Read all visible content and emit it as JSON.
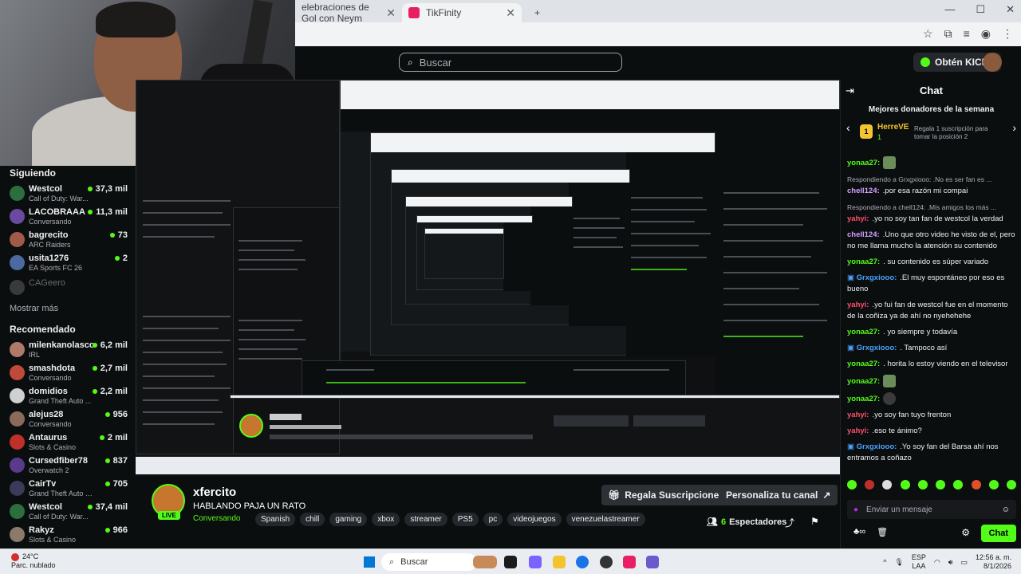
{
  "browser": {
    "tabs": [
      {
        "label": "elebraciones de Gol con Neym",
        "active": false
      },
      {
        "label": "TikFinity",
        "active": true
      }
    ],
    "new_tab": "+",
    "win_minimize": "—",
    "win_maximize": "☐",
    "win_close": "✕"
  },
  "header": {
    "search_placeholder": "Buscar",
    "kicks_button": "Obtén KICKs"
  },
  "sidebar": {
    "following_title": "Siguiendo",
    "following": [
      {
        "name": "Westcol",
        "sub": "Call of Duty: War...",
        "viewers": "37,3 mil",
        "color": "#2b6f3f"
      },
      {
        "name": "LACOBRAAA",
        "sub": "Conversando",
        "viewers": "11,3 mil",
        "color": "#6a4aa0"
      },
      {
        "name": "bagrecito",
        "sub": "ARC Raiders",
        "viewers": "73",
        "color": "#a05a4a"
      },
      {
        "name": "usita1276",
        "sub": "EA Sports FC 26",
        "viewers": "2",
        "color": "#4a6aa0"
      },
      {
        "name": "CAGeero",
        "sub": "",
        "viewers": "",
        "color": "#3a3a3a",
        "offline": true
      }
    ],
    "show_more": "Mostrar más",
    "recommended_title": "Recomendado",
    "recommended": [
      {
        "name": "milenkanolasco",
        "sub": "IRL",
        "viewers": "6,2 mil",
        "color": "#b07a6a"
      },
      {
        "name": "smashdota",
        "sub": "Conversando",
        "viewers": "2,7 mil",
        "color": "#c04a3a"
      },
      {
        "name": "domidios",
        "sub": "Grand Theft Auto ...",
        "viewers": "2,2 mil",
        "color": "#d0d0d0"
      },
      {
        "name": "alejus28",
        "sub": "Conversando",
        "viewers": "956",
        "color": "#8a6a5a"
      },
      {
        "name": "Antaurus",
        "sub": "Slots & Casino",
        "viewers": "2 mil",
        "color": "#c0302a"
      },
      {
        "name": "Cursedfiber78",
        "sub": "Overwatch 2",
        "viewers": "837",
        "color": "#5a3a8a"
      },
      {
        "name": "CairTv",
        "sub": "Grand Theft Auto V (G...",
        "viewers": "705",
        "color": "#3a3a5a"
      },
      {
        "name": "Westcol",
        "sub": "Call of Duty: War...",
        "viewers": "37,4 mil",
        "color": "#2b6f3f"
      },
      {
        "name": "Rakyz",
        "sub": "Slots & Casino",
        "viewers": "966",
        "color": "#8a7a6a"
      }
    ]
  },
  "channel": {
    "name": "xfercito",
    "title": "HABLANDO PAJA UN RATO",
    "category": "Conversando",
    "live_badge": "LIVE",
    "tags": [
      "Spanish",
      "chill",
      "gaming",
      "xbox",
      "streamer",
      "PS5",
      "pc",
      "videojuegos",
      "venezuelastreamer"
    ],
    "gift_button": "Regala Suscripciones",
    "customize_button": "Personaliza tu canal",
    "viewers_count": "6",
    "viewers_label": "Espectadores"
  },
  "chat": {
    "title": "Chat",
    "donors_title": "Mejores donadores de la semana",
    "donor_rank": "1",
    "donor_name": "HerreVE",
    "donor_amount": "1",
    "donor_gift_text": "Regala 1 suscripción para tomar la posición 2",
    "messages": [
      {
        "user": "yonaa27:",
        "text": "",
        "color": "#53fc18",
        "emote": "img"
      },
      {
        "reply": true,
        "text": "Respondiendo a Grxgxiooo: .No es ser fan es ..."
      },
      {
        "user": "chell124:",
        "text": ".por esa razón mi compai",
        "color": "#d0a0ff"
      },
      {
        "reply": true,
        "text": "Respondiendo a chell124: .Mis amigos los más ..."
      },
      {
        "user": "yahyi:",
        "text": ".yo no soy tan fan de westcol la verdad",
        "color": "#ff4f6d"
      },
      {
        "user": "chell124:",
        "text": ".Uno que otro video he visto de el, pero no me llama mucho la atención su contenido",
        "color": "#d0a0ff"
      },
      {
        "user": "yonaa27:",
        "text": ". su contenido es súper variado",
        "color": "#53fc18"
      },
      {
        "user": "Grxgxiooo:",
        "text": ".El muy espontáneo por eso es bueno",
        "color": "#4aa3ff",
        "badge": true
      },
      {
        "user": "yahyi:",
        "text": ".yo fui fan de westcol fue en el momento de la coñiza ya de ahí no nyehehehe",
        "color": "#ff4f6d"
      },
      {
        "user": "yonaa27:",
        "text": ". yo siempre y todavía",
        "color": "#53fc18"
      },
      {
        "user": "Grxgxiooo:",
        "text": ". Tampoco así",
        "color": "#4aa3ff",
        "badge": true
      },
      {
        "user": "yonaa27:",
        "text": ". horita lo estoy viendo en el televisor",
        "color": "#53fc18"
      },
      {
        "user": "yonaa27:",
        "text": "",
        "color": "#53fc18",
        "emote": "img"
      },
      {
        "user": "yonaa27:",
        "text": "",
        "color": "#53fc18",
        "emote": "dark"
      },
      {
        "user": "yahyi:",
        "text": ".yo soy fan tuyo frenton",
        "color": "#ff4f6d"
      },
      {
        "user": "yahyi:",
        "text": ".eso te ánimo?",
        "color": "#ff4f6d"
      },
      {
        "user": "Grxgxiooo:",
        "text": ".Yo soy fan del Barsa ahí nos entramos a coñazo",
        "color": "#4aa3ff",
        "badge": true
      }
    ],
    "input_placeholder": "Enviar un mensaje",
    "send_button": "Chat"
  },
  "taskbar": {
    "weather_temp": "24°C",
    "weather_desc": "Parc. nublado",
    "search_label": "Buscar",
    "lang": "ESP",
    "lang2": "LAA",
    "time": "12:56 a. m.",
    "date": "8/1/2026"
  }
}
